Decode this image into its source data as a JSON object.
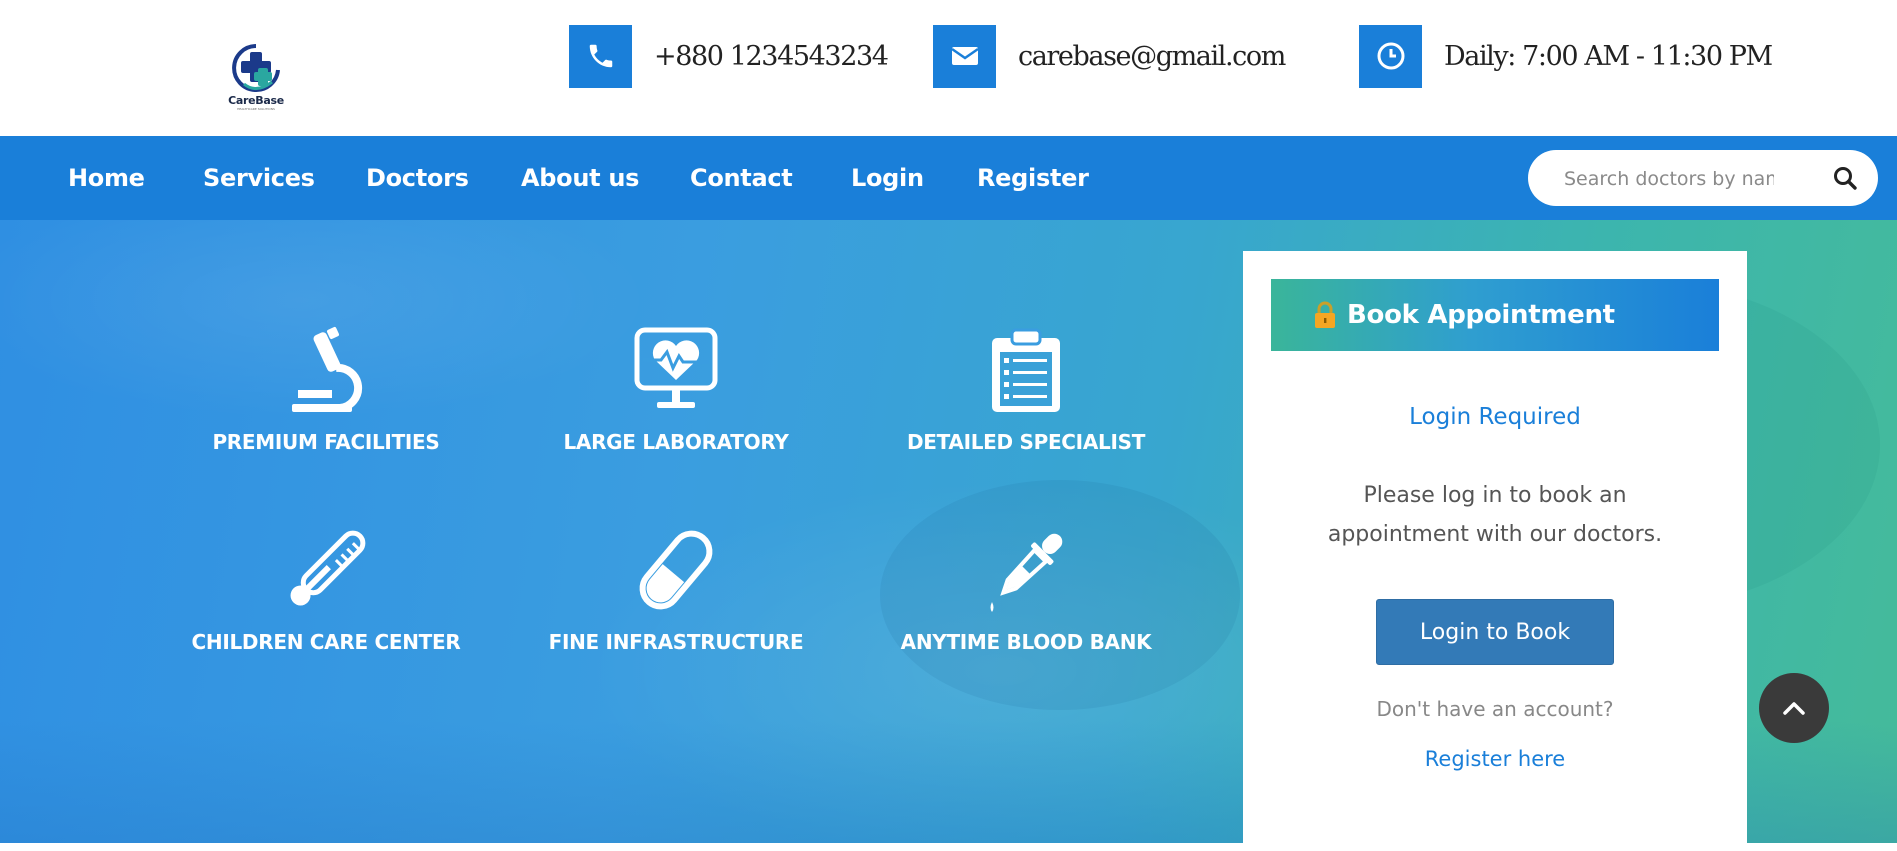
{
  "brand": {
    "name": "CareBase",
    "tagline": "HEALTHCARE SOLUTIONS"
  },
  "contacts": {
    "phone": {
      "icon": "phone-icon",
      "text": "+880 1234543234"
    },
    "email": {
      "icon": "envelope-icon",
      "text": "carebase@gmail.com"
    },
    "hours": {
      "icon": "clock-icon",
      "text": "Daily: 7:00 AM - 11:30 PM"
    }
  },
  "nav": {
    "items": [
      "Home",
      "Services",
      "Doctors",
      "About us",
      "Contact",
      "Login",
      "Register"
    ]
  },
  "search": {
    "placeholder": "Search doctors by name...",
    "icon": "search-icon"
  },
  "features": [
    {
      "icon": "microscope-icon",
      "label": "PREMIUM FACILITIES"
    },
    {
      "icon": "heart-monitor-icon",
      "label": "LARGE LABORATORY"
    },
    {
      "icon": "clipboard-icon",
      "label": "DETAILED SPECIALIST"
    },
    {
      "icon": "thermometer-icon",
      "label": "CHILDREN CARE CENTER"
    },
    {
      "icon": "pill-icon",
      "label": "FINE INFRASTRUCTURE"
    },
    {
      "icon": "dropper-icon",
      "label": "ANYTIME BLOOD BANK"
    }
  ],
  "appointment": {
    "icon": "lock-icon",
    "title": "Book Appointment",
    "status": "Login Required",
    "message": "Please log in to book an appointment with our doctors.",
    "button": "Login to Book",
    "no_account": "Don't have an account?",
    "register_link": "Register here"
  },
  "colors": {
    "primary": "#1a7fd9",
    "teal": "#3ab59a",
    "button": "#337ab7",
    "dark": "#3a3a3a"
  }
}
